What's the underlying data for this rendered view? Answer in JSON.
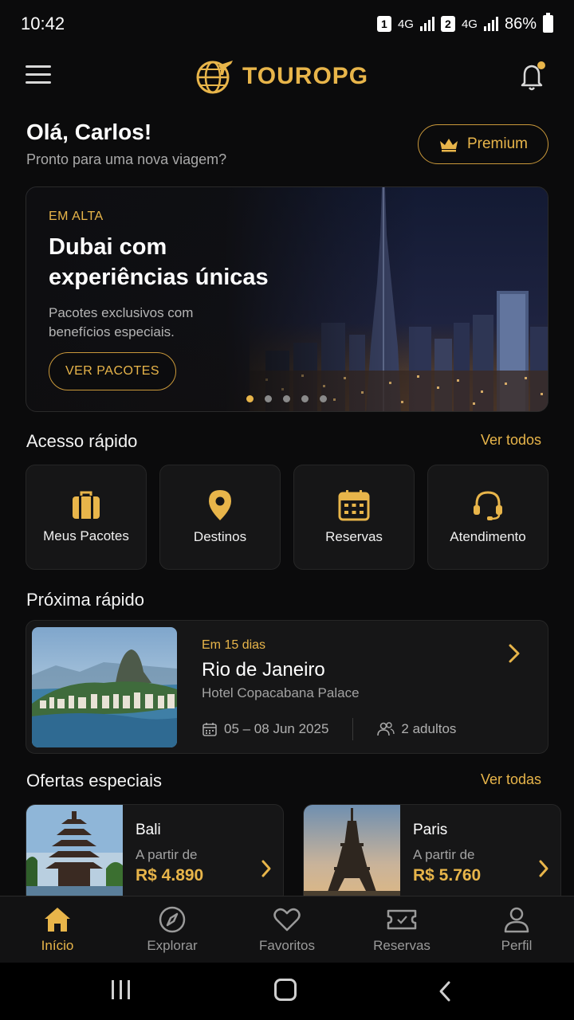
{
  "status_bar": {
    "time": "10:42",
    "sim1": "1",
    "sim2": "2",
    "network": "4G",
    "battery": "86%"
  },
  "header": {
    "app_name": "TOUROPG",
    "menu_icon": "hamburger-icon",
    "notification_icon": "bell-icon"
  },
  "greeting": {
    "title": "Olá, Carlos!",
    "subtitle": "Pronto para uma nova viagem?",
    "premium_label": "Premium"
  },
  "hero": {
    "tag": "EM ALTA",
    "title": "Dubai com experiências únicas",
    "description": "Pacotes exclusivos com benefícios especiais.",
    "button_label": "VER PACOTES",
    "dots_total": 5,
    "active_dot": 0
  },
  "quick_access": {
    "title": "Acesso rápido",
    "link": "Ver todos",
    "items": [
      {
        "label": "Meus Pacotes",
        "icon": "suitcase-icon"
      },
      {
        "label": "Destinos",
        "icon": "map-pin-icon"
      },
      {
        "label": "Reservas",
        "icon": "calendar-icon"
      },
      {
        "label": "Atendimento",
        "icon": "headset-icon"
      }
    ]
  },
  "upcoming": {
    "title": "Próxima rápido",
    "when": "Em 15 dias",
    "city": "Rio de Janeiro",
    "hotel": "Hotel Copacabana Palace",
    "dates": "05 – 08 Jun 2025",
    "guests": "2 adultos"
  },
  "offers": {
    "title": "Ofertas especiais",
    "link": "Ver todas",
    "items": [
      {
        "name": "Bali",
        "from_label": "A partir de",
        "price": "R$ 4.890"
      },
      {
        "name": "Paris",
        "from_label": "A partir de",
        "price": "R$ 5.760"
      }
    ]
  },
  "bottom_nav": {
    "items": [
      {
        "label": "Início",
        "icon": "home-icon",
        "active": true
      },
      {
        "label": "Explorar",
        "icon": "compass-icon",
        "active": false
      },
      {
        "label": "Favoritos",
        "icon": "heart-icon",
        "active": false
      },
      {
        "label": "Reservas",
        "icon": "ticket-icon",
        "active": false
      },
      {
        "label": "Perfil",
        "icon": "user-icon",
        "active": false
      }
    ]
  },
  "colors": {
    "accent": "#e8b54a",
    "background": "#0b0b0c",
    "card": "#161617"
  }
}
